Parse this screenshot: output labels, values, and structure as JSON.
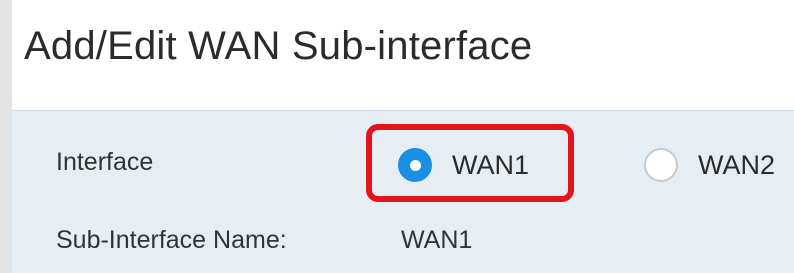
{
  "page": {
    "title": "Add/Edit WAN Sub-interface"
  },
  "form": {
    "interface_label": "Interface",
    "interface_options": [
      {
        "label": "WAN1",
        "selected": true
      },
      {
        "label": "WAN2",
        "selected": false
      }
    ],
    "sub_interface_name_label": "Sub-Interface Name:",
    "sub_interface_name_value": "WAN1"
  },
  "colors": {
    "highlight": "#e5131a",
    "radio_selected": "#1a8fe3",
    "panel_background": "#e6eef4"
  }
}
